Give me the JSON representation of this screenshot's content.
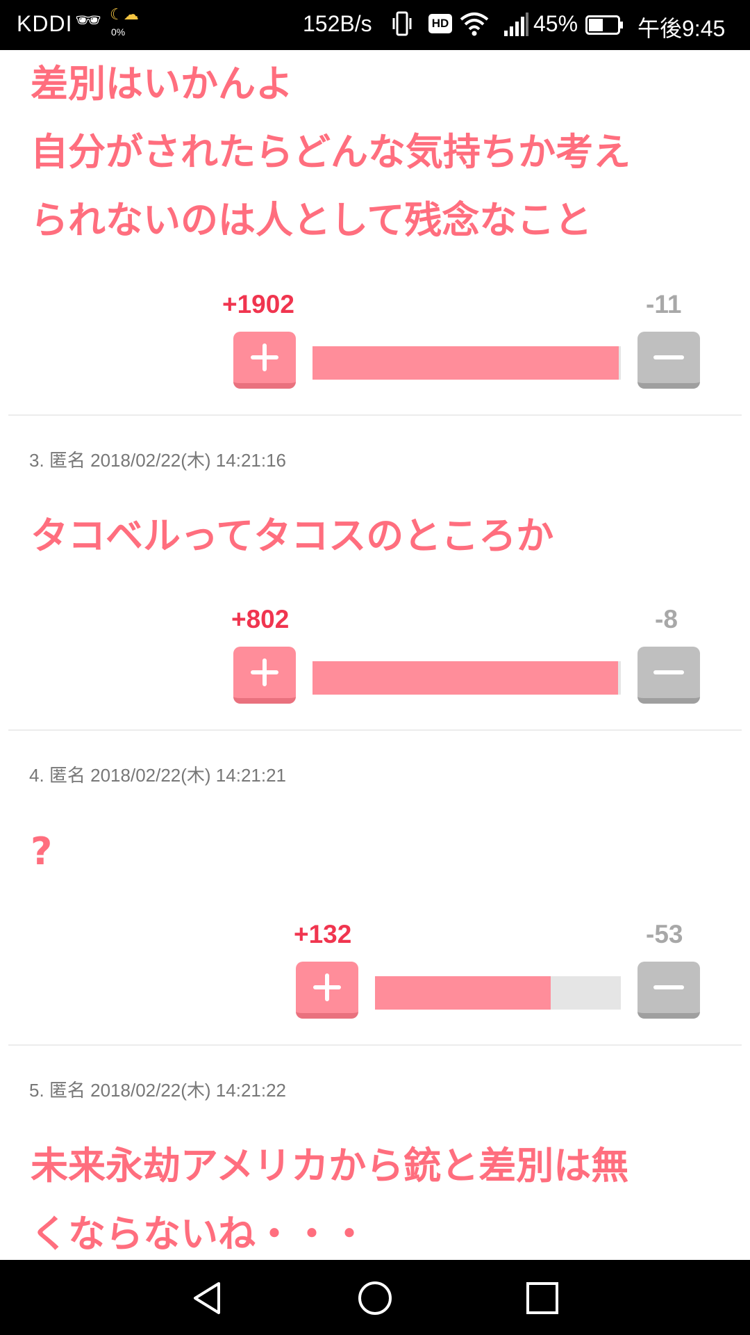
{
  "status_bar": {
    "carrier": "KDDI",
    "weather_percent": "0%",
    "network_speed": "152B/s",
    "hd_badge": "HD",
    "battery_percent": "45%",
    "time": "午後9:45"
  },
  "comments": [
    {
      "text_lines": [
        "差別はいかんよ",
        "自分がされたらどんな気持ちか考え",
        "られないのは人として残念なこと"
      ],
      "plus": "+1902",
      "minus": "-11",
      "ratio": 0.994
    },
    {
      "meta": "3. 匿名 2018/02/22(木) 14:21:16",
      "text_lines": [
        "タコベルってタコスのところか"
      ],
      "plus": "+802",
      "minus": "-8",
      "ratio": 0.99
    },
    {
      "meta": "4. 匿名 2018/02/22(木) 14:21:21",
      "text_lines": [
        "?"
      ],
      "plus": "+132",
      "minus": "-53",
      "ratio": 0.714
    },
    {
      "meta": "5. 匿名 2018/02/22(木) 14:21:22",
      "text_lines": [
        "未来永劫アメリカから銃と差別は無",
        "くならないね・・・"
      ]
    }
  ],
  "colors": {
    "accent_text": "#ff6e7e",
    "plus_count": "#f0354f",
    "minus_count": "#a8a8a8",
    "bar_fill": "#ff8d9a",
    "bar_track": "#e5e5e5"
  },
  "icons": [
    "plus-icon",
    "minus-icon",
    "back-icon",
    "home-icon",
    "recents-icon",
    "wifi-icon",
    "signal-icon",
    "battery-icon",
    "vibrate-icon"
  ]
}
